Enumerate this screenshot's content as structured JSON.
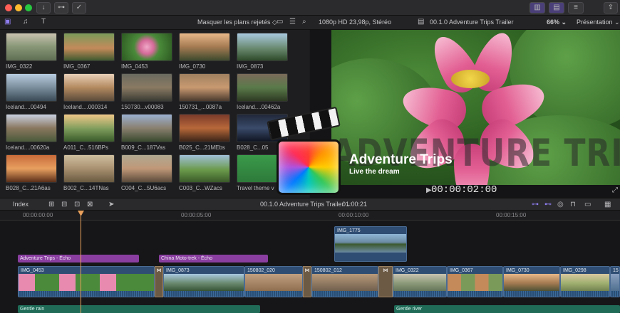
{
  "colors": {
    "accent": "#8a3fa0",
    "video_clip": "#2f4d72",
    "audio_clip": "#1f6b58",
    "playhead": "#e8a05c"
  },
  "toolbar": {
    "filter_label": "Masquer les plans rejetés ◇",
    "format_label": "1080p HD 23,98p, Stéréo",
    "project_label": "00.1.0 Adventure Trips Trailer",
    "zoom_label": "66% ⌄",
    "view_label": "Présentation ⌄"
  },
  "browser": {
    "clips": [
      {
        "label": "IMG_0322"
      },
      {
        "label": "IMG_0367"
      },
      {
        "label": "IMG_0453"
      },
      {
        "label": "IMG_0730"
      },
      {
        "label": "IMG_0873"
      },
      {
        "label": "Iceland....00494"
      },
      {
        "label": "Iceland....000314"
      },
      {
        "label": "150730...v00083"
      },
      {
        "label": "150731_...0087a"
      },
      {
        "label": "Iceland....00462a"
      },
      {
        "label": "Iceland....00620a"
      },
      {
        "label": "A011_C...516BPs"
      },
      {
        "label": "B009_C...187Vas"
      },
      {
        "label": "B025_C...21MEbs"
      },
      {
        "label": "B028_C...05"
      },
      {
        "label": "B028_C...21A6as"
      },
      {
        "label": "B002_C...14TNas"
      },
      {
        "label": "C004_C...5U6acs"
      },
      {
        "label": "C003_C...WZacs"
      },
      {
        "label": "Travel theme v"
      }
    ]
  },
  "viewer": {
    "overlay_title": "ADVENTURE TRIPS",
    "timecode": "00:00:02:00"
  },
  "logo": {
    "title": "Adventure Trips",
    "subtitle": "Live the dream"
  },
  "timeline_bar": {
    "index_label": "Index",
    "project_label": "00.1.0 Adventure Trips Trailer ⌄",
    "duration": "01:00:21"
  },
  "ruler": {
    "ticks": [
      "00:00:00:00",
      "00:00:05:00",
      "00:00:10:00",
      "00:00:15:00"
    ]
  },
  "timeline": {
    "connected_clip": "IMG_1775",
    "titles": [
      "Adventure Trips - Écho",
      "China Moto-trek - Écho"
    ],
    "video_clips": [
      "IMG_0453",
      "IMG_0873",
      "150802_020",
      "150802_012",
      "IMG_0322",
      "IMG_0367",
      "IMG_0730",
      "IMG_0298",
      "15"
    ],
    "audio_clips": [
      "Gentle rain",
      "Gentle river"
    ]
  }
}
